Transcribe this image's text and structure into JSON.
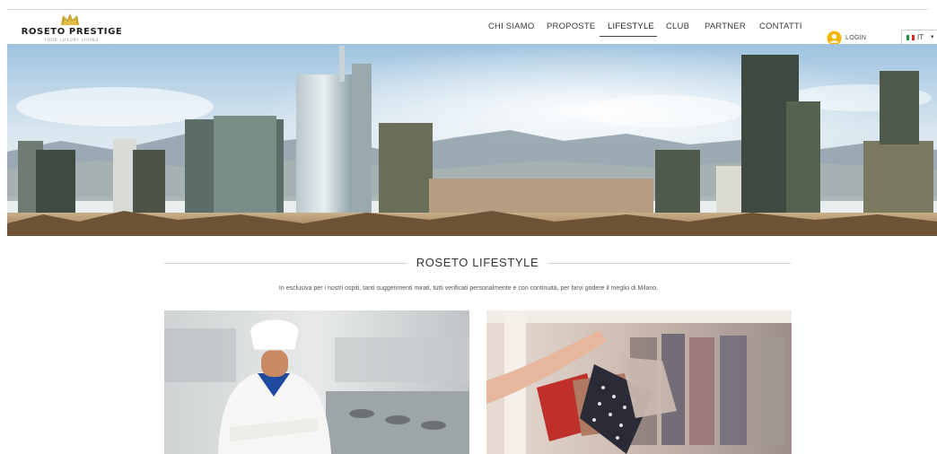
{
  "brand": {
    "name": "ROSETO PRESTIGE",
    "tagline": "YOUR LUXURY LIVING",
    "gold": "#c9a227"
  },
  "nav": {
    "items": [
      {
        "label": "CHI SIAMO",
        "active": false
      },
      {
        "label": "PROPOSTE",
        "active": false
      },
      {
        "label": "LIFESTYLE",
        "active": true
      },
      {
        "label": "CLUB",
        "active": false
      },
      {
        "label": "PARTNER",
        "active": false
      },
      {
        "label": "CONTATTI",
        "active": false
      }
    ],
    "login_label": "LOGIN",
    "login_icon": "user-circle-icon",
    "language": "IT",
    "language_icon": "italy-flag-icon"
  },
  "hero": {
    "image": "milan-skyline-photo"
  },
  "section": {
    "title": "ROSETO LIFESTYLE",
    "intro": "In esclusiva per i nostri ospiti, tanti suggerimenti mirati, tutti verificati personalmente e con continuità, per farvi godere il meglio di Milano."
  },
  "cards": [
    {
      "image": "chef-in-kitchen-photo"
    },
    {
      "image": "shopping-bags-photo"
    }
  ]
}
